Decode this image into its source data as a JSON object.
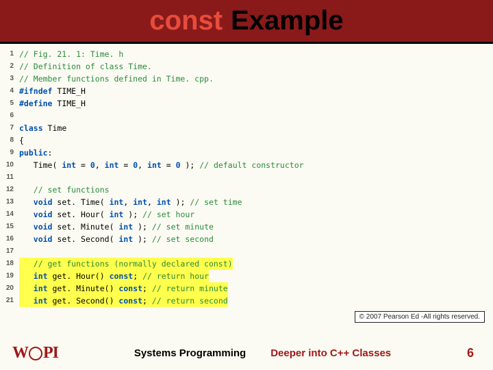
{
  "title": {
    "keyword": "const",
    "rest": "Example"
  },
  "code_lines": [
    {
      "n": "1",
      "segments": [
        {
          "cls": "cm",
          "t": "// Fig. 21. 1: Time. h"
        }
      ]
    },
    {
      "n": "2",
      "segments": [
        {
          "cls": "cm",
          "t": "// Definition of class Time."
        }
      ]
    },
    {
      "n": "3",
      "segments": [
        {
          "cls": "cm",
          "t": "// Member functions defined in Time. cpp."
        }
      ]
    },
    {
      "n": "4",
      "segments": [
        {
          "cls": "pp",
          "t": "#ifndef "
        },
        {
          "cls": "id",
          "t": "TIME_H"
        }
      ]
    },
    {
      "n": "5",
      "segments": [
        {
          "cls": "pp",
          "t": "#define "
        },
        {
          "cls": "id",
          "t": "TIME_H"
        }
      ]
    },
    {
      "n": "6",
      "segments": [
        {
          "cls": "id",
          "t": ""
        }
      ]
    },
    {
      "n": "7",
      "segments": [
        {
          "cls": "kw",
          "t": "class "
        },
        {
          "cls": "id",
          "t": "Time"
        }
      ]
    },
    {
      "n": "8",
      "segments": [
        {
          "cls": "id",
          "t": "{"
        }
      ]
    },
    {
      "n": "9",
      "segments": [
        {
          "cls": "kw",
          "t": "public"
        },
        {
          "cls": "id",
          "t": ":"
        }
      ]
    },
    {
      "n": "10",
      "segments": [
        {
          "cls": "id",
          "t": "   Time( "
        },
        {
          "cls": "kw",
          "t": "int"
        },
        {
          "cls": "id",
          "t": " = "
        },
        {
          "cls": "kw",
          "t": "0"
        },
        {
          "cls": "id",
          "t": ", "
        },
        {
          "cls": "kw",
          "t": "int"
        },
        {
          "cls": "id",
          "t": " = "
        },
        {
          "cls": "kw",
          "t": "0"
        },
        {
          "cls": "id",
          "t": ", "
        },
        {
          "cls": "kw",
          "t": "int"
        },
        {
          "cls": "id",
          "t": " = "
        },
        {
          "cls": "kw",
          "t": "0"
        },
        {
          "cls": "id",
          "t": " ); "
        },
        {
          "cls": "cm",
          "t": "// default constructor"
        }
      ]
    },
    {
      "n": "11",
      "segments": [
        {
          "cls": "id",
          "t": ""
        }
      ]
    },
    {
      "n": "12",
      "segments": [
        {
          "cls": "id",
          "t": "   "
        },
        {
          "cls": "cm",
          "t": "// set functions"
        }
      ]
    },
    {
      "n": "13",
      "segments": [
        {
          "cls": "id",
          "t": "   "
        },
        {
          "cls": "kw",
          "t": "void"
        },
        {
          "cls": "id",
          "t": " set. Time( "
        },
        {
          "cls": "kw",
          "t": "int"
        },
        {
          "cls": "id",
          "t": ", "
        },
        {
          "cls": "kw",
          "t": "int"
        },
        {
          "cls": "id",
          "t": ", "
        },
        {
          "cls": "kw",
          "t": "int"
        },
        {
          "cls": "id",
          "t": " ); "
        },
        {
          "cls": "cm",
          "t": "// set time"
        }
      ]
    },
    {
      "n": "14",
      "segments": [
        {
          "cls": "id",
          "t": "   "
        },
        {
          "cls": "kw",
          "t": "void"
        },
        {
          "cls": "id",
          "t": " set. Hour( "
        },
        {
          "cls": "kw",
          "t": "int"
        },
        {
          "cls": "id",
          "t": " ); "
        },
        {
          "cls": "cm",
          "t": "// set hour"
        }
      ]
    },
    {
      "n": "15",
      "segments": [
        {
          "cls": "id",
          "t": "   "
        },
        {
          "cls": "kw",
          "t": "void"
        },
        {
          "cls": "id",
          "t": " set. Minute( "
        },
        {
          "cls": "kw",
          "t": "int"
        },
        {
          "cls": "id",
          "t": " ); "
        },
        {
          "cls": "cm",
          "t": "// set minute"
        }
      ]
    },
    {
      "n": "16",
      "segments": [
        {
          "cls": "id",
          "t": "   "
        },
        {
          "cls": "kw",
          "t": "void"
        },
        {
          "cls": "id",
          "t": " set. Second( "
        },
        {
          "cls": "kw",
          "t": "int"
        },
        {
          "cls": "id",
          "t": " ); "
        },
        {
          "cls": "cm",
          "t": "// set second"
        }
      ]
    },
    {
      "n": "17",
      "segments": [
        {
          "cls": "id",
          "t": ""
        }
      ]
    },
    {
      "n": "18",
      "hl": true,
      "segments": [
        {
          "cls": "id",
          "t": "   "
        },
        {
          "cls": "cm",
          "t": "// get functions (normally declared const)"
        }
      ]
    },
    {
      "n": "19",
      "hl": true,
      "segments": [
        {
          "cls": "id",
          "t": "   "
        },
        {
          "cls": "kw",
          "t": "int"
        },
        {
          "cls": "id",
          "t": " get. Hour() "
        },
        {
          "cls": "kw",
          "t": "const"
        },
        {
          "cls": "id",
          "t": "; "
        },
        {
          "cls": "cm",
          "t": "// return hour"
        }
      ]
    },
    {
      "n": "20",
      "hl": true,
      "segments": [
        {
          "cls": "id",
          "t": "   "
        },
        {
          "cls": "kw",
          "t": "int"
        },
        {
          "cls": "id",
          "t": " get. Minute() "
        },
        {
          "cls": "kw",
          "t": "const"
        },
        {
          "cls": "id",
          "t": "; "
        },
        {
          "cls": "cm",
          "t": "// return minute"
        }
      ]
    },
    {
      "n": "21",
      "hl": true,
      "segments": [
        {
          "cls": "id",
          "t": "   "
        },
        {
          "cls": "kw",
          "t": "int"
        },
        {
          "cls": "id",
          "t": " get. Second() "
        },
        {
          "cls": "kw",
          "t": "const"
        },
        {
          "cls": "id",
          "t": "; "
        },
        {
          "cls": "cm",
          "t": "// return second"
        }
      ]
    }
  ],
  "copyright": "© 2007 Pearson Ed -All rights reserved.",
  "footer": {
    "logo_text": "WPI",
    "center1": "Systems Programming",
    "center2": "Deeper into C++ Classes",
    "pagenum": "6"
  }
}
